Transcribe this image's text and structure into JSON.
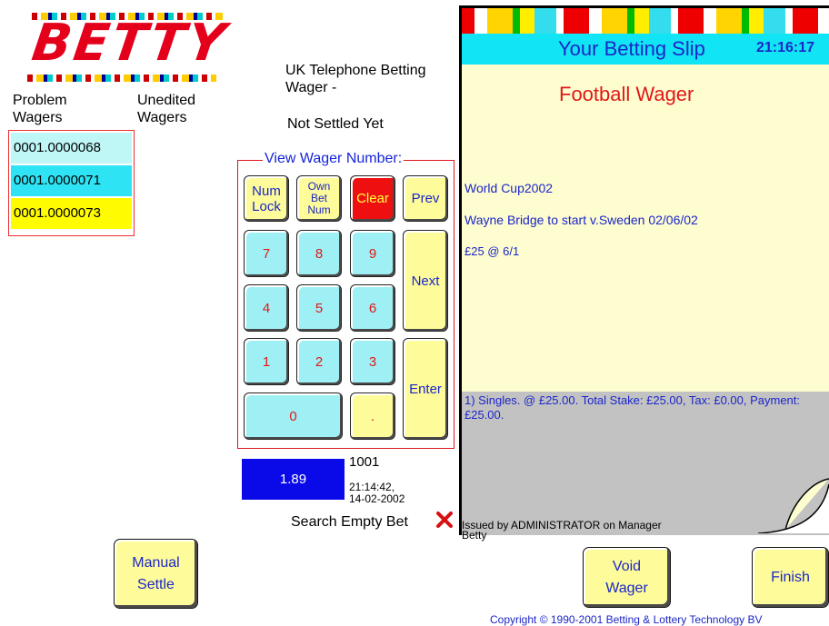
{
  "logo": {
    "text": "BETTY"
  },
  "left_panel": {
    "problem_label": "Problem\nWagers",
    "unedited_label": "Unedited\nWagers",
    "wagers": [
      {
        "number": "0001.0000068",
        "color": "#bff7f7"
      },
      {
        "number": "0001.0000071",
        "color": "#2ee4f4"
      },
      {
        "number": "0001.0000073",
        "color": "#fffb00"
      }
    ]
  },
  "info": {
    "title": "UK Telephone Betting\nWager -",
    "status": "Not Settled Yet"
  },
  "keypad": {
    "title": "View Wager Number:",
    "keys": {
      "num_lock": "Num\nLock",
      "own_bet_num": "Own\nBet\nNum",
      "clear": "Clear",
      "prev": "Prev",
      "next": "Next",
      "enter": "Enter",
      "k7": "7",
      "k8": "8",
      "k9": "9",
      "k4": "4",
      "k5": "5",
      "k6": "6",
      "k1": "1",
      "k2": "2",
      "k3": "3",
      "k0": "0",
      "dot": "."
    }
  },
  "terminal": {
    "amount": "1.89",
    "id": "1001",
    "timestamp": "21:14:42,\n14-02-2002"
  },
  "search": {
    "label": "Search Empty Bet"
  },
  "slip": {
    "title": "Your Betting Slip",
    "time": "21:16:17",
    "heading": "Football Wager",
    "event": "World Cup2002",
    "selection": "Wayne Bridge to start v.Sweden 02/06/02",
    "stake_odds": "£25 @ 6/1",
    "summary": "1) Singles.  @ £25.00. Total Stake: £25.00, Tax: £0.00, Payment: £25.00.",
    "issued": "Issued by ADMINISTRATOR on Manager\nBetty"
  },
  "buttons": {
    "manual_settle": "Manual\nSettle",
    "void_wager": "Void\nWager",
    "finish": "Finish"
  },
  "footer": {
    "copyright": "Copyright © 1990-2001 Betting & Lottery Technology BV"
  },
  "colors": {
    "accent_red": "#e4001b",
    "keypad_cyan": "#9ff0f4",
    "keypad_yellow": "#fefc9a",
    "slip_header": "#11e4f4",
    "terminal_blue": "#0a0ae8"
  }
}
